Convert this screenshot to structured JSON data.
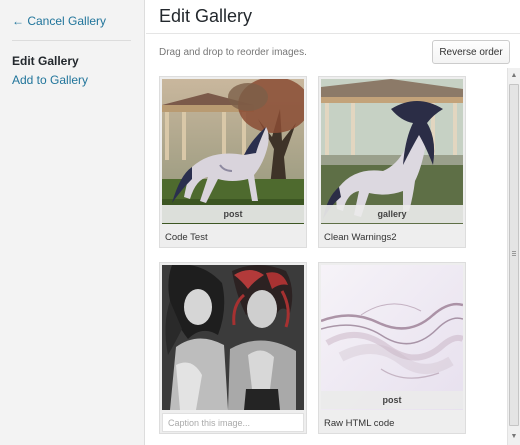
{
  "sidebar": {
    "cancel_label": "← Cancel Gallery",
    "items": [
      {
        "label": "Edit Gallery"
      },
      {
        "label": "Add to Gallery"
      }
    ]
  },
  "header": {
    "title": "Edit Gallery"
  },
  "toolbar": {
    "instructions": "Drag and drop to reorder images.",
    "reverse_label": "Reverse order"
  },
  "gallery": {
    "items": [
      {
        "image": "carousel horse with blue mane under tree",
        "type": "post",
        "caption": "Code Test"
      },
      {
        "image": "white horse with dark mane in front of carousel",
        "type": "gallery",
        "caption": "Clean Warnings2"
      },
      {
        "image": "black and white illustration of two women with red hair",
        "type": "",
        "caption": "",
        "caption_placeholder": "Caption this image..."
      },
      {
        "image": "lavender abstract smoke swirl",
        "type": "post",
        "caption": "Raw HTML code"
      }
    ]
  },
  "colors": {
    "link": "#21759b",
    "sidebar_bg": "#f3f3f3",
    "card_bg": "#eeeeee"
  }
}
